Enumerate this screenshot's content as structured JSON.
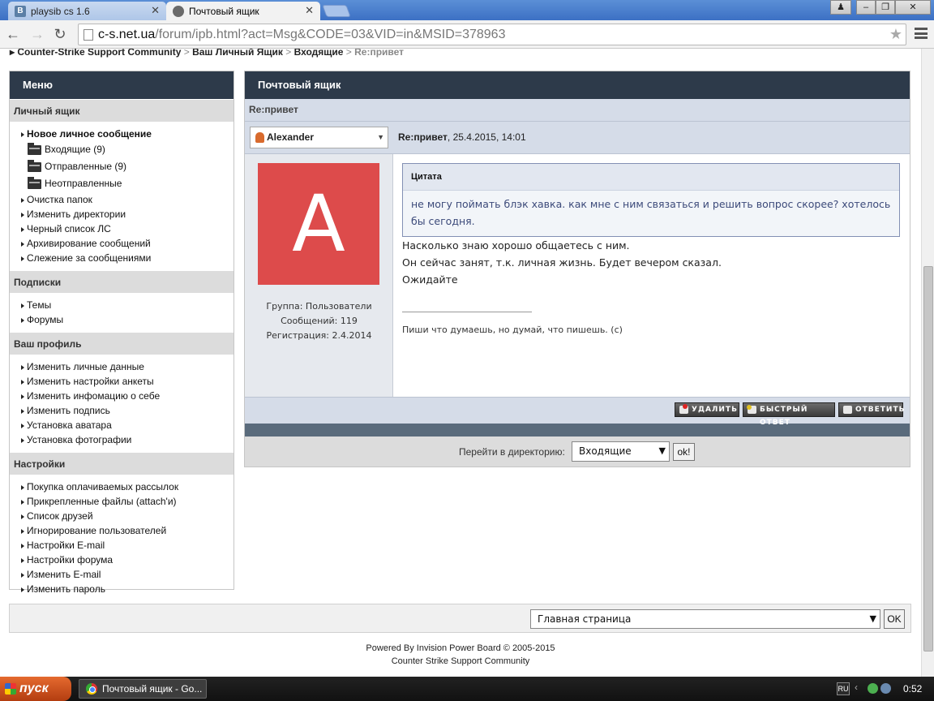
{
  "browser": {
    "tabs": [
      {
        "label": "playsib cs 1.6",
        "icon": "vk-icon",
        "icon_text": "B"
      },
      {
        "label": "Почтовый ящик",
        "icon": "user-icon"
      }
    ],
    "url_host": "c-s.net.ua",
    "url_path": "/forum/ipb.html?act=Msg&CODE=03&VID=in&MSID=378963"
  },
  "breadcrumb": {
    "prefix": "▸",
    "items": [
      "Counter-Strike Support Community",
      "Ваш Личный Ящик",
      "Входящие"
    ],
    "separator": ">",
    "current": "Re:привет"
  },
  "sidebar": {
    "title": "Меню",
    "sections": [
      {
        "title": "Личный ящик"
      },
      {
        "title": "Подписки"
      },
      {
        "title": "Ваш профиль"
      },
      {
        "title": "Настройки"
      }
    ],
    "personal": {
      "new_message": "Новое личное сообщение",
      "folders": [
        "Входящие (9)",
        "Отправленные (9)",
        "Неотправленные"
      ],
      "items": [
        "Очистка папок",
        "Изменить директории",
        "Черный список ЛС",
        "Архивирование сообщений",
        "Слежение за сообщениями"
      ]
    },
    "subscriptions": [
      "Темы",
      "Форумы"
    ],
    "profile": [
      "Изменить личные данные",
      "Изменить настройки анкеты",
      "Изменить инфомацию о себе",
      "Изменить подпись",
      "Установка аватара",
      "Установка фотографии"
    ],
    "settings": [
      "Покупка оплачиваемых рассылок",
      "Прикрепленные файлы (attach'и)",
      "Список друзей",
      "Игнорирование пользователей",
      "Настройки E-mail",
      "Настройки форума",
      "Изменить E-mail",
      "Изменить пароль"
    ]
  },
  "main": {
    "title": "Почтовый ящик",
    "subject": "Re:привет",
    "author": "Alexander",
    "post_subject": "Re:привет",
    "post_date": ", 25.4.2015, 14:01",
    "avatar_letter": "A",
    "avatar_color": "#dd4b4b",
    "author_group": "Группа: Пользователи",
    "author_posts": "Сообщений: 119",
    "author_reg": "Регистрация: 2.4.2014",
    "quote_title": "Цитата",
    "quote_text": "не могу поймать блэк хавка. как мне с ним связаться и решить вопрос скорее? хотелось бы сегодня.",
    "message_lines": [
      "Насколько знаю хорошо общаетесь с ним.",
      "Он сейчас занят, т.к. личная жизнь. Будет вечером сказал.",
      "Ожидайте"
    ],
    "signature": "Пиши что думаешь, но думай, что пишешь. (c)",
    "buttons": {
      "delete": "УДАЛИТЬ",
      "quick_reply": "БЫСТРЫЙ ОТВЕТ",
      "reply": "ОТВЕТИТЬ"
    },
    "jump_label": "Перейти в директорию:",
    "jump_value": "Входящие",
    "jump_ok": "ok!"
  },
  "bottom": {
    "select_value": "Главная страница",
    "ok": "OK"
  },
  "footer": {
    "line1": "Powered By Invision Power Board  © 2005-2015",
    "line2": "Counter Strike Support Community"
  },
  "taskbar": {
    "start": "пуск",
    "task": "Почтовый ящик - Go...",
    "lang": "RU",
    "clock": "0:52"
  },
  "colors": {
    "header_dark": "#2d3a4a",
    "subheader": "#d5dce8",
    "quote_text": "#3c4a7a"
  }
}
